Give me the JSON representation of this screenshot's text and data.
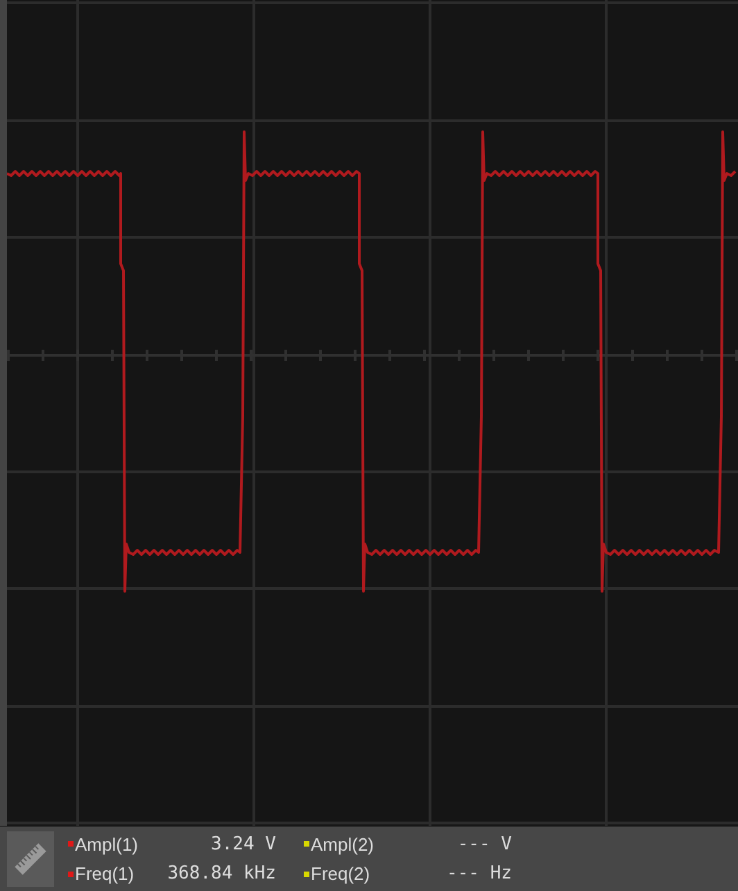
{
  "measurements": [
    {
      "label": "Ampl(1)",
      "value": "3.24 V",
      "color": "#e01818"
    },
    {
      "label": "Ampl(2)",
      "value": "--- V",
      "color": "#d8d800"
    },
    {
      "label": "Freq(1)",
      "value": "368.84 kHz",
      "color": "#e01818"
    },
    {
      "label": "Freq(2)",
      "value": "--- Hz",
      "color": "#d8d800"
    }
  ]
}
